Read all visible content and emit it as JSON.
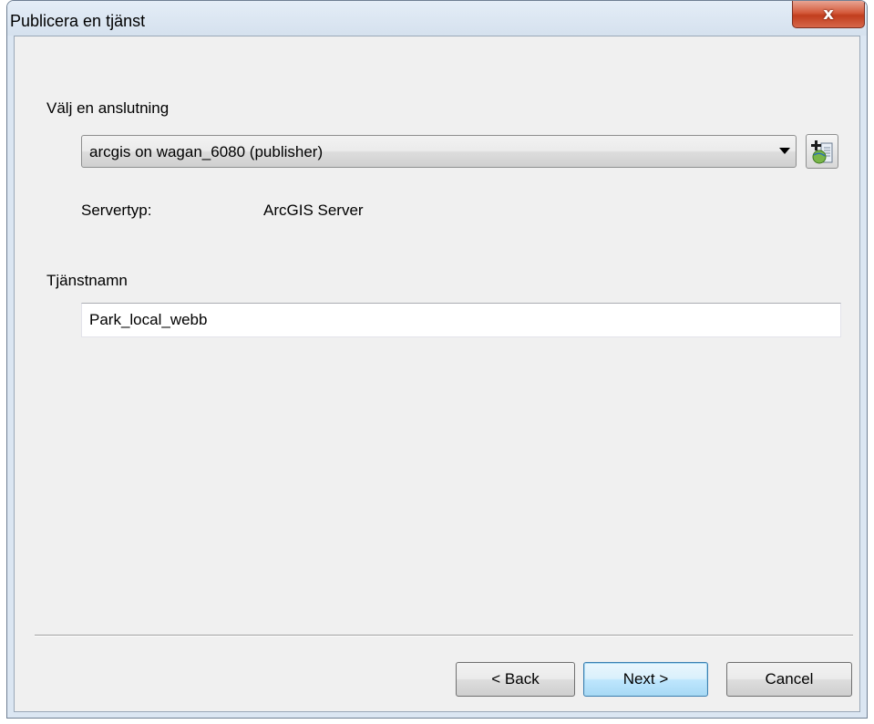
{
  "window": {
    "title": "Publicera en tjänst",
    "close_glyph": "x"
  },
  "connection": {
    "label": "Välj en anslutning",
    "selected": "arcgis on wagan_6080 (publisher)",
    "add_icon": "add-server-connection-icon"
  },
  "server_type": {
    "label": "Servertyp:",
    "value": "ArcGIS Server"
  },
  "service_name": {
    "label": "Tjänstnamn",
    "value": "Park_local_webb"
  },
  "buttons": {
    "back": "< Back",
    "next": "Next >",
    "cancel": "Cancel"
  },
  "colors": {
    "close_button": "#c13d1d",
    "default_button": "#bee6fd"
  }
}
